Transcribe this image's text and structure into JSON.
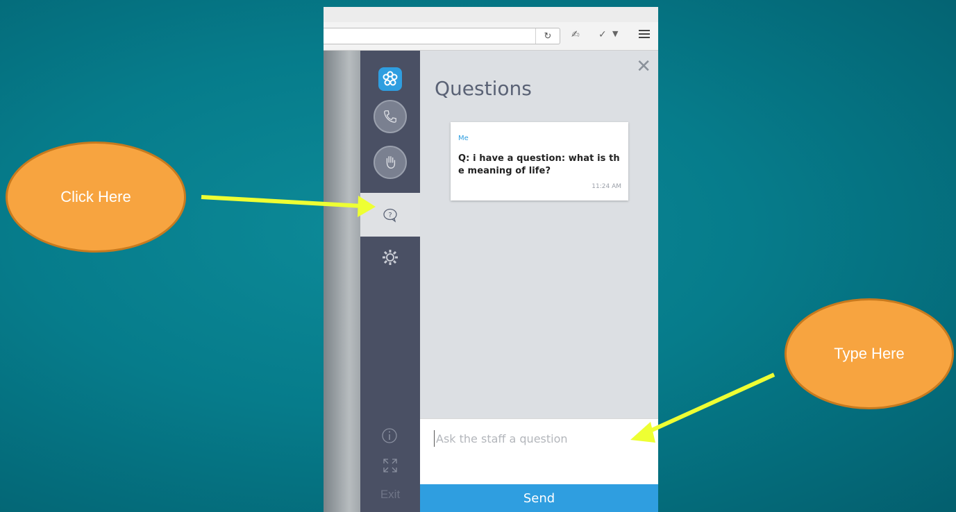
{
  "browser": {
    "reload_icon": "reload-icon",
    "menu_icon": "hamburger-menu-icon"
  },
  "sidebar": {
    "logo_icon": "flower-logo-icon",
    "items": [
      {
        "name": "call",
        "icon": "phone-icon"
      },
      {
        "name": "raise-hand",
        "icon": "hand-icon"
      },
      {
        "name": "questions",
        "icon": "question-bubble-icon",
        "active": true
      },
      {
        "name": "settings",
        "icon": "gear-icon"
      }
    ],
    "info_icon": "info-icon",
    "expand_icon": "expand-icon",
    "exit_label": "Exit"
  },
  "panel": {
    "title": "Questions",
    "close_icon": "close-icon",
    "messages": [
      {
        "author": "Me",
        "text": "Q: i have a question: what is th e meaning of life?",
        "time": "11:24 AM"
      }
    ],
    "input_placeholder": "Ask the staff a question",
    "send_label": "Send"
  },
  "annotations": {
    "click_here": "Click Here",
    "type_here": "Type Here",
    "callout_color": "#f7a440",
    "arrow_color": "#eeff33"
  },
  "colors": {
    "accent": "#2f9ee0",
    "sidebar": "#4a5064",
    "panel": "#dcdfe3"
  }
}
